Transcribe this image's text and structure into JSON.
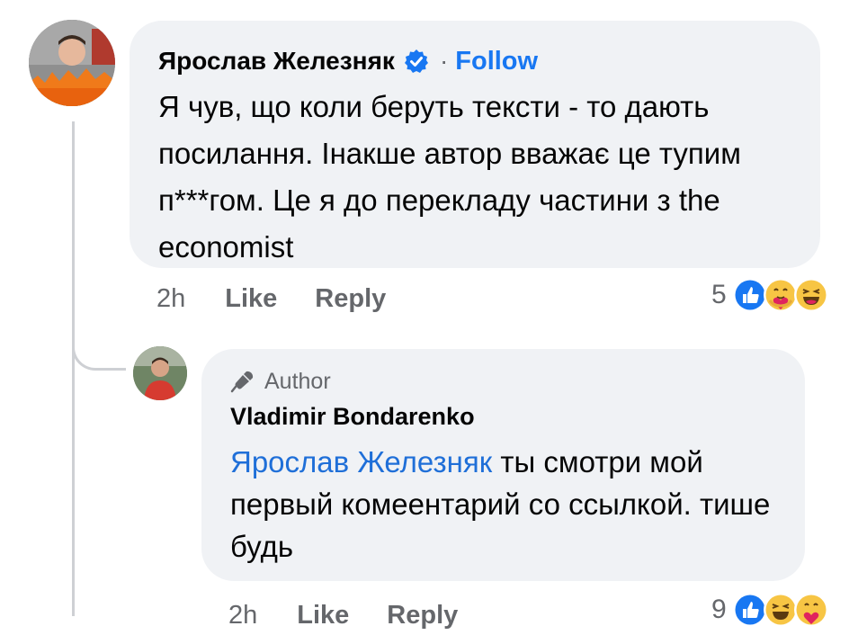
{
  "comment": {
    "author": "Ярослав Железняк",
    "follow_label": "Follow",
    "separator": "·",
    "text": "Я чув, що коли беруть тексти - то дають посилання. Інакше автор вважає це тупим п***гом. Це я до перекладу частини з the economist",
    "time": "2h",
    "like_label": "Like",
    "reply_label": "Reply",
    "reaction_count": "5",
    "reactions": [
      "like-icon",
      "care-icon",
      "haha-icon"
    ]
  },
  "reply": {
    "badge": "Author",
    "author": "Vladimir Bondarenko",
    "mention": "Ярослав Железняк",
    "text": " ты смотри мой первый комеентарий со ссылкой. тише будь",
    "time": "2h",
    "like_label": "Like",
    "reply_label": "Reply",
    "reaction_count": "9",
    "reactions": [
      "like-icon",
      "haha-icon",
      "care-icon"
    ]
  },
  "colors": {
    "link_blue": "#1877f2",
    "bubble_bg": "#f0f2f5",
    "secondary_text": "#65676b"
  }
}
